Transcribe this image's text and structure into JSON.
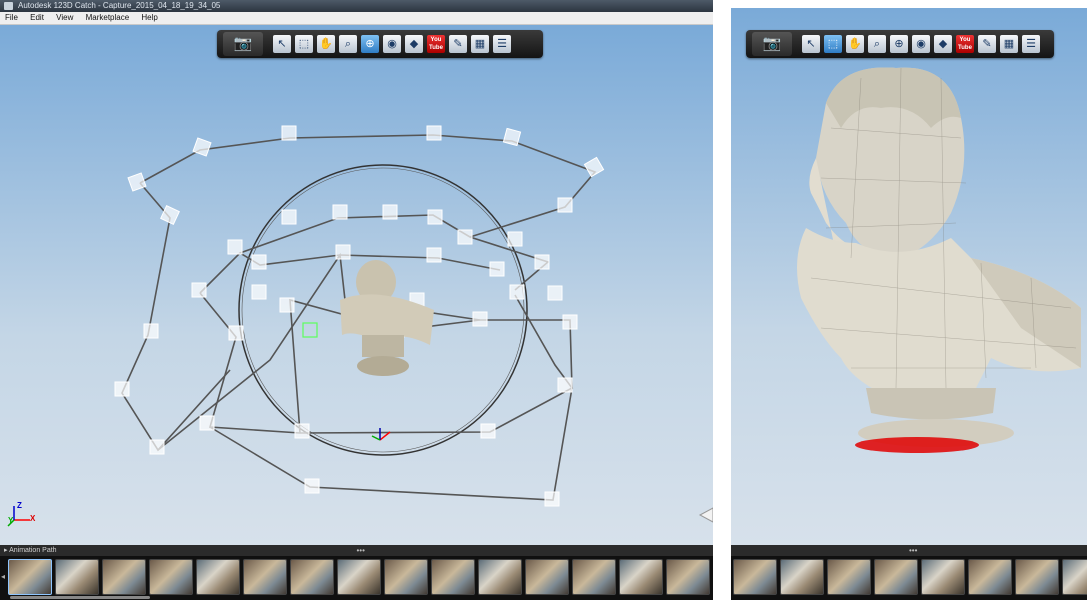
{
  "app": {
    "title": "Autodesk 123D Catch - Capture_2015_04_18_19_34_05",
    "menus": [
      "File",
      "Edit",
      "View",
      "Marketplace",
      "Help"
    ]
  },
  "toolbar": {
    "camera_icon": "camera-icon",
    "tools": [
      {
        "name": "select-tool",
        "glyph": "↖"
      },
      {
        "name": "lasso-select-tool",
        "glyph": "⬚"
      },
      {
        "name": "pan-tool",
        "glyph": "✋"
      },
      {
        "name": "zoom-tool",
        "glyph": "⌕"
      },
      {
        "name": "orbit-tool",
        "glyph": "⊕"
      },
      {
        "name": "camera-view-tool",
        "glyph": "◉"
      },
      {
        "name": "share-tool",
        "glyph": "◆"
      },
      {
        "name": "youtube-tool",
        "glyph": "You Tube"
      },
      {
        "name": "pen-tool",
        "glyph": "✎"
      },
      {
        "name": "export-tool",
        "glyph": "▦"
      },
      {
        "name": "notes-tool",
        "glyph": "☰"
      }
    ]
  },
  "left_view": {
    "axis_labels": {
      "x": "X",
      "y": "Y",
      "z": "Z"
    }
  },
  "filmstrip": {
    "header": "Animation Path",
    "dots": "•••",
    "left_thumbnail_count": 16,
    "right_thumbnail_count": 8
  },
  "colors": {
    "accent": "#2f7cc4",
    "toolbar_bg": "#1e1e1e",
    "selection_red": "#e00000"
  }
}
